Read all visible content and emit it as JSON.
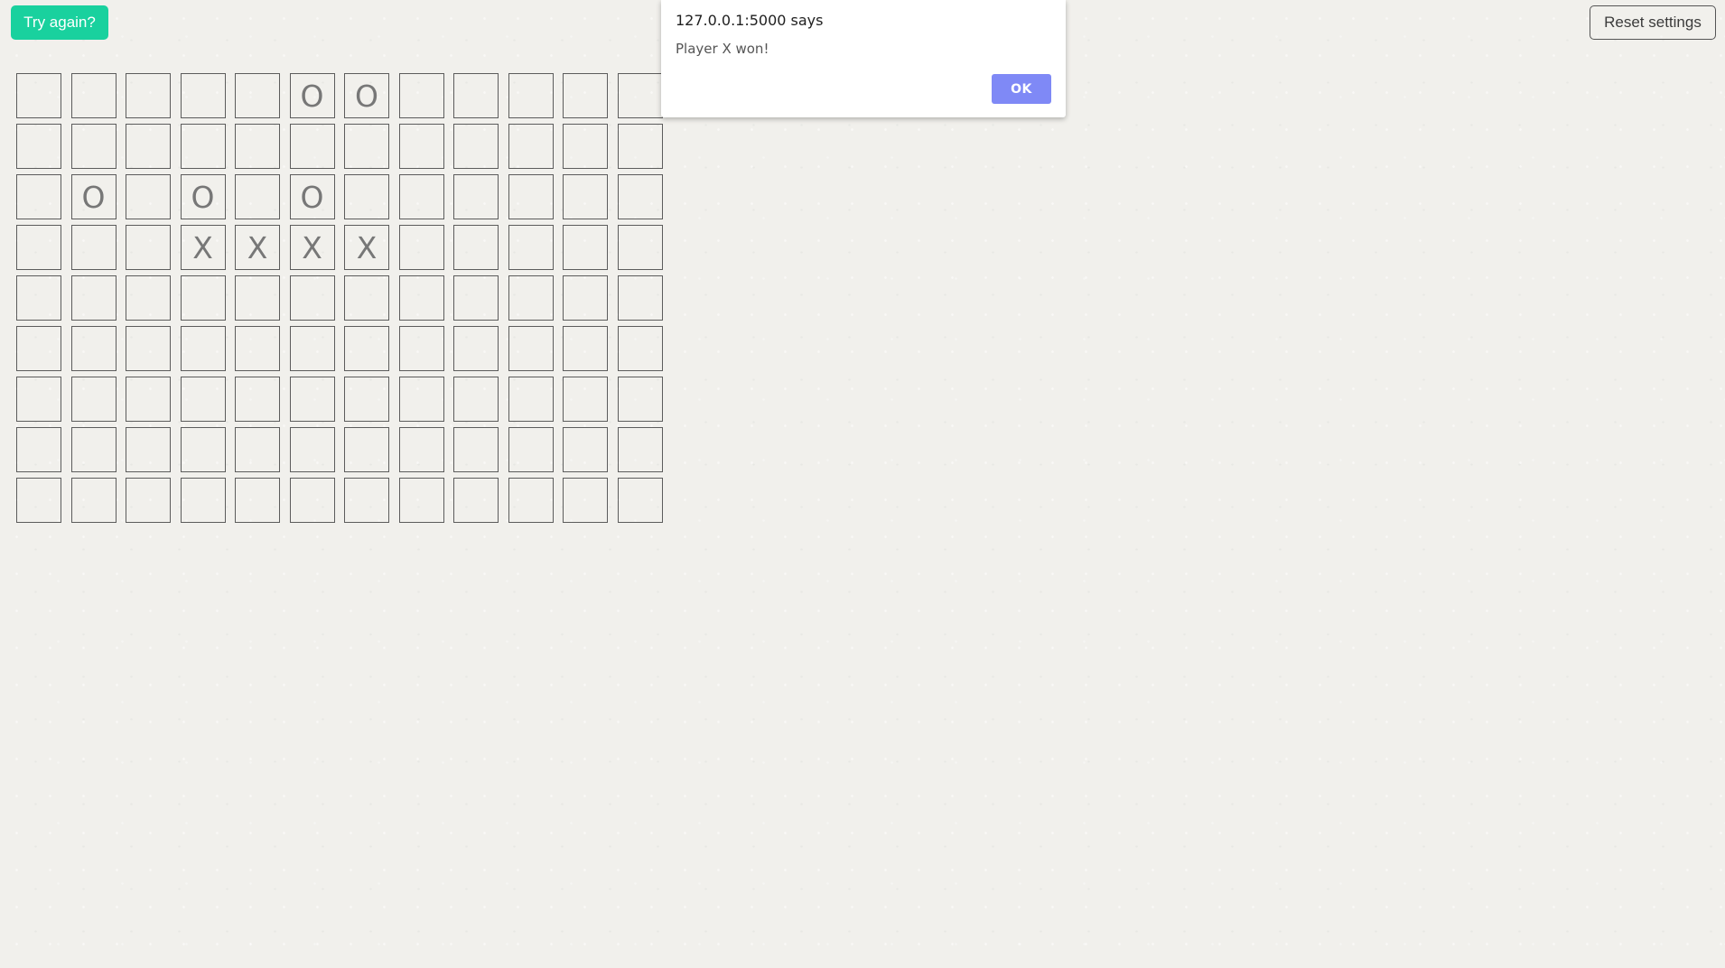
{
  "controls": {
    "try_again_label": "Try again?",
    "reset_settings_label": "Reset settings"
  },
  "board": {
    "rows": 9,
    "cols": 12,
    "cells": [
      [
        "",
        "",
        "",
        "",
        "",
        "O",
        "O",
        "",
        "",
        "",
        "",
        ""
      ],
      [
        "",
        "",
        "",
        "",
        "",
        "",
        "",
        "",
        "",
        "",
        "",
        ""
      ],
      [
        "",
        "O",
        "",
        "O",
        "",
        "O",
        "",
        "",
        "",
        "",
        "",
        ""
      ],
      [
        "",
        "",
        "",
        "X",
        "X",
        "X",
        "X",
        "",
        "",
        "",
        "",
        ""
      ],
      [
        "",
        "",
        "",
        "",
        "",
        "",
        "",
        "",
        "",
        "",
        "",
        ""
      ],
      [
        "",
        "",
        "",
        "",
        "",
        "",
        "",
        "",
        "",
        "",
        "",
        ""
      ],
      [
        "",
        "",
        "",
        "",
        "",
        "",
        "",
        "",
        "",
        "",
        "",
        ""
      ],
      [
        "",
        "",
        "",
        "",
        "",
        "",
        "",
        "",
        "",
        "",
        "",
        ""
      ],
      [
        "",
        "",
        "",
        "",
        "",
        "",
        "",
        "",
        "",
        "",
        "",
        ""
      ]
    ]
  },
  "dialog": {
    "title": "127.0.0.1:5000 says",
    "message": "Player X won!",
    "ok_label": "OK"
  },
  "colors": {
    "try_again_bg": "#19d19e",
    "ok_button_bg": "#7f89f6",
    "page_bg": "#f1f0ec"
  }
}
